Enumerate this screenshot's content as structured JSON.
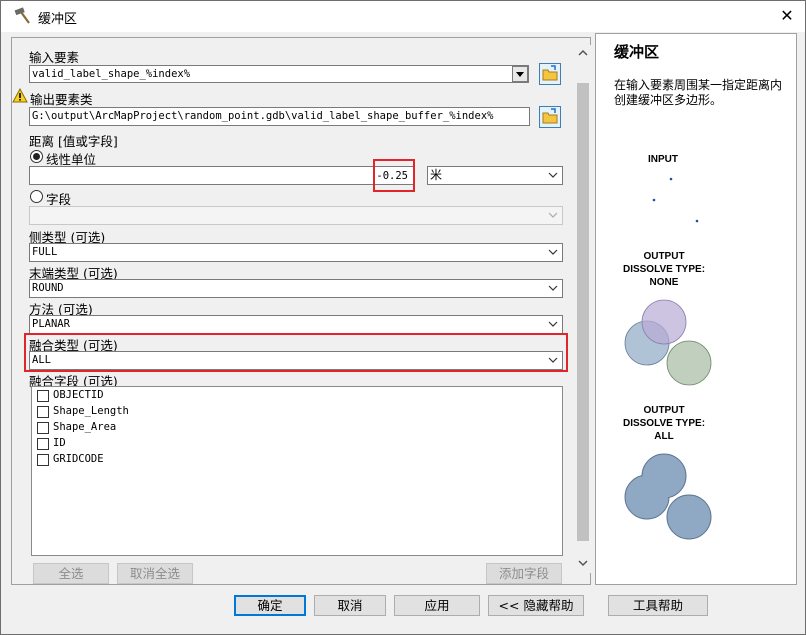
{
  "window": {
    "title": "缓冲区",
    "close_glyph": "✕"
  },
  "form": {
    "input_features": {
      "label": "输入要素",
      "value": "valid_label_shape_%index%"
    },
    "output_class": {
      "label": "输出要素类",
      "value": "G:\\output\\ArcMapProject\\random_point.gdb\\valid_label_shape_buffer_%index%"
    },
    "distance": {
      "label": "距离 [值或字段]",
      "linear_unit_label": "线性单位",
      "value": "-0.25",
      "unit": "米",
      "field_label": "字段",
      "field_value": ""
    },
    "side_type": {
      "label": "侧类型 (可选)",
      "value": "FULL"
    },
    "end_type": {
      "label": "末端类型 (可选)",
      "value": "ROUND"
    },
    "method": {
      "label": "方法 (可选)",
      "value": "PLANAR"
    },
    "dissolve_type": {
      "label": "融合类型 (可选)",
      "value": "ALL"
    },
    "dissolve_field": {
      "label": "融合字段 (可选)",
      "items": [
        "OBJECTID",
        "Shape_Length",
        "Shape_Area",
        "ID",
        "GRIDCODE"
      ]
    },
    "list_buttons": {
      "select_all": "全选",
      "deselect_all": "取消全选",
      "add_field": "添加字段"
    }
  },
  "footer": {
    "ok": "确定",
    "cancel": "取消",
    "apply": "应用",
    "hide_help": "<< 隐藏帮助",
    "tool_help": "工具帮助"
  },
  "help": {
    "title": "缓冲区",
    "description": "在输入要素周围某一指定距离内创建缓冲区多边形。",
    "input_label": "INPUT",
    "none_label_1": "OUTPUT",
    "none_label_2": "DISSOLVE TYPE:",
    "none_label_3": "NONE",
    "all_label_1": "OUTPUT",
    "all_label_2": "DISSOLVE TYPE:",
    "all_label_3": "ALL"
  },
  "colors": {
    "highlight_red": "#e0252b",
    "circle_purple": "#b8abd4",
    "circle_blue": "#8fa9c4",
    "circle_green": "#a6bca3"
  }
}
